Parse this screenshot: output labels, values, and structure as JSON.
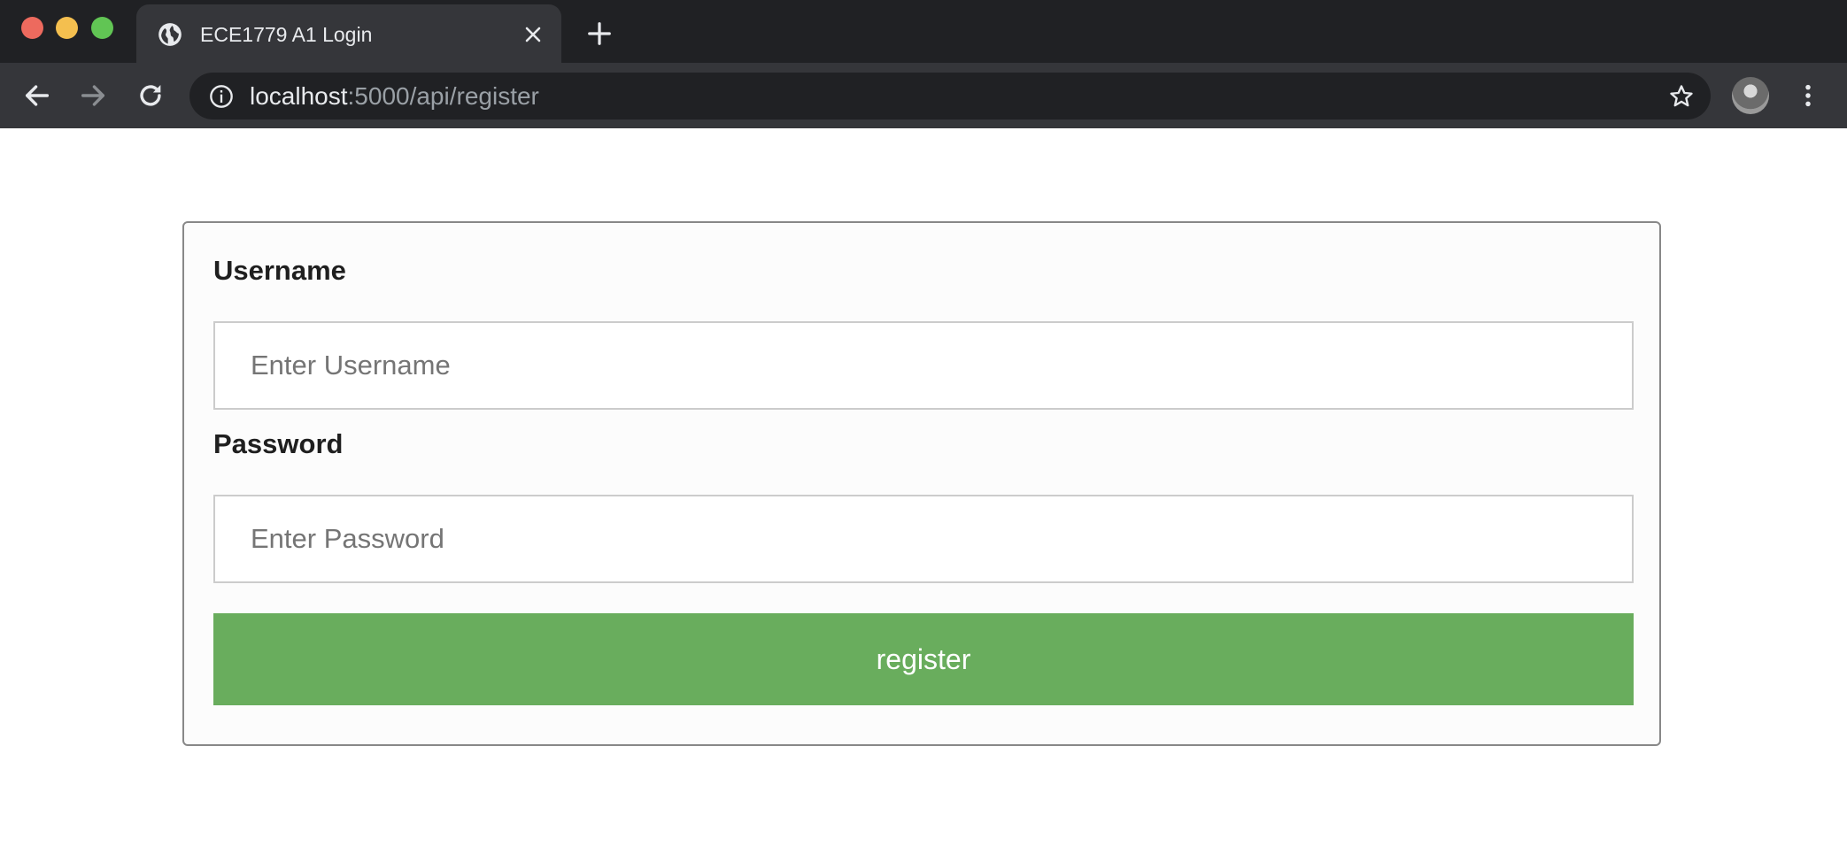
{
  "browser": {
    "tab": {
      "title": "ECE1779 A1 Login",
      "favicon": "globe-icon"
    },
    "address_bar": {
      "host": "localhost",
      "path": ":5000/api/register"
    },
    "icons": {
      "back": "arrow-left-icon",
      "forward": "arrow-right-icon",
      "reload": "reload-icon",
      "info": "info-icon",
      "bookmark": "star-icon",
      "menu": "kebab-menu-icon",
      "new_tab": "plus-icon",
      "close_tab": "close-icon"
    },
    "colors": {
      "frame": "#202124",
      "toolbar": "#35363a",
      "close_dot": "#ed6a5e",
      "minimize_dot": "#f4bf4f",
      "maximize_dot": "#61c554"
    }
  },
  "form": {
    "username": {
      "label": "Username",
      "placeholder": "Enter Username",
      "value": ""
    },
    "password": {
      "label": "Password",
      "placeholder": "Enter Password",
      "value": ""
    },
    "submit": {
      "label": "register",
      "color": "#69ad5d"
    }
  }
}
